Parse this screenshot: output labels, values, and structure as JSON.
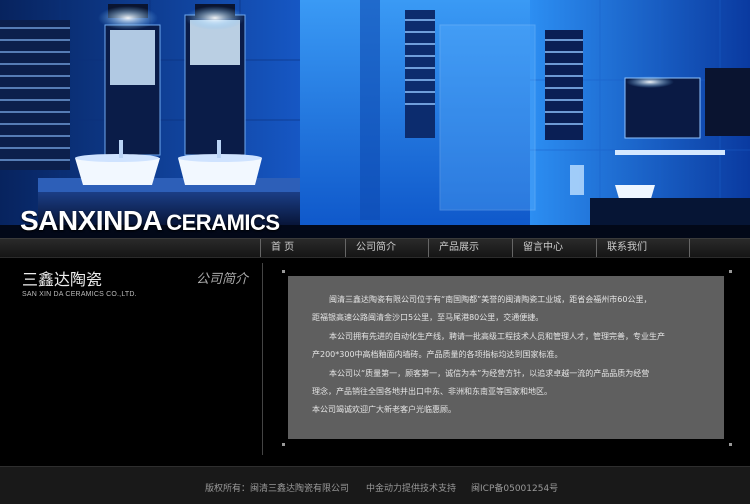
{
  "brand": {
    "main": "SANXINDA",
    "sub": "CERAMICS"
  },
  "nav": {
    "items": [
      {
        "label": "首  页"
      },
      {
        "label": "公司简介"
      },
      {
        "label": "产品展示"
      },
      {
        "label": "留言中心"
      },
      {
        "label": "联系我们"
      }
    ]
  },
  "sidebar": {
    "title": "三鑫达陶瓷",
    "subtitle": "SAN XIN DA CERAMICS CO.,LTD."
  },
  "section": {
    "title": "公司简介"
  },
  "content": {
    "paragraphs": [
      "闽清三鑫达陶瓷有限公司位于有“南国陶都”美誉的闽清陶瓷工业城，距省会福州市60公里，",
      "距福银高速公路闽清金沙口5公里，至马尾港80公里，交通便捷。",
      "本公司拥有先进的自动化生产线，聘请一批高级工程技术人员和管理人才，管理完善，专业生产",
      "产200*300中高档釉面内墙砖。产品质量的各项指标均达到国家标准。",
      "本公司以“质量第一，顾客第一，诚信为本”为经营方针，以追求卓越一流的产品品质为经营",
      "理念，产品销往全国各地并出口中东、非洲和东南亚等国家和地区。",
      "本公司竭诚欢迎广大新老客户光临惠顾。"
    ]
  },
  "footer": {
    "copyright": "版权所有：闽清三鑫达陶瓷有限公司",
    "tech": "中金动力提供技术支持",
    "icp": "闽ICP备05001254号"
  }
}
